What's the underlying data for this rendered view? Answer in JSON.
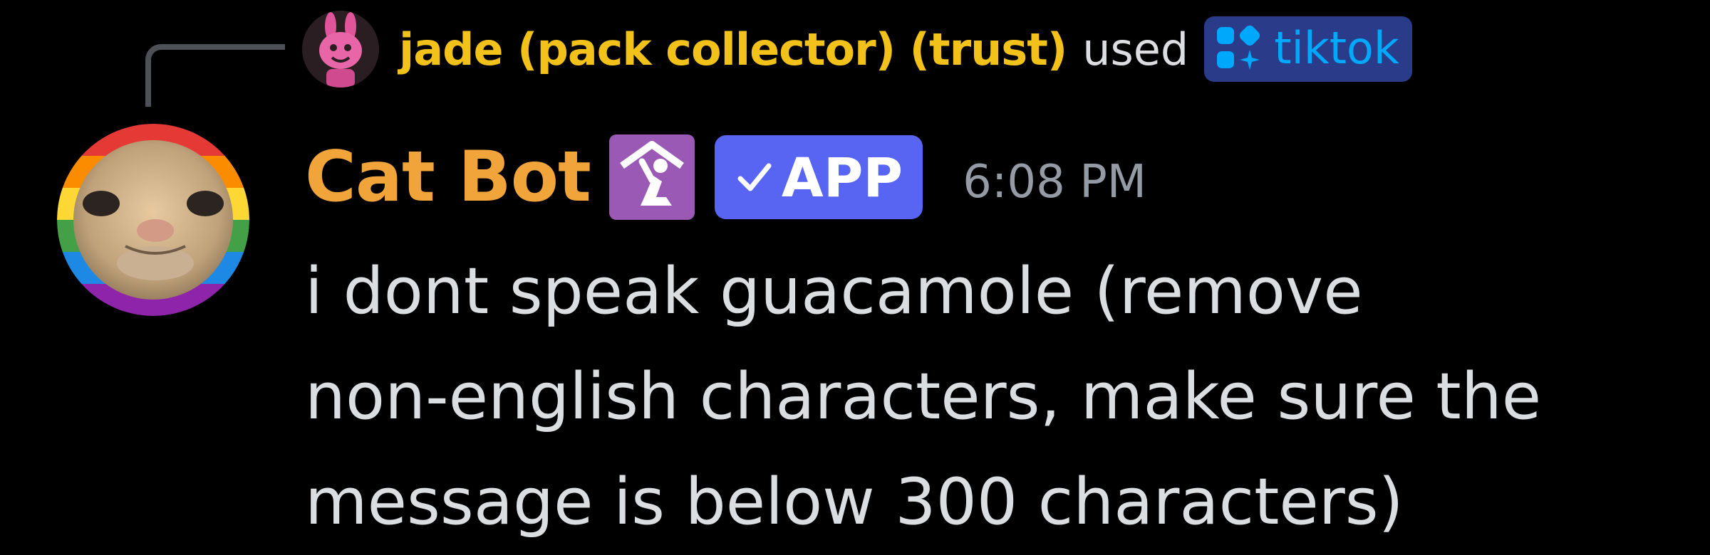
{
  "reply": {
    "username": "jade (pack collector) (trust)",
    "used_text": "used",
    "command_icon": "app-command-icon",
    "command_name": "tiktok"
  },
  "message": {
    "author": "Cat Bot",
    "role_icon": "kneeling-figure-role-icon",
    "app_badge": {
      "icon": "check-icon",
      "label": "APP"
    },
    "timestamp": "6:08 PM",
    "content": "i dont speak guacamole (remove\nnon-english characters, make sure the\nmessage is below 300 characters)"
  },
  "colors": {
    "background": "#000000",
    "reply_username": "#f2c21a",
    "author_name": "#f0a43a",
    "command_pill_bg": "#2a3b8a",
    "command_text": "#00a8fc",
    "app_badge_bg": "#5865f2",
    "role_icon_bg": "#9b59b6",
    "timestamp": "#949ba4",
    "message_text": "#dbdee1"
  }
}
